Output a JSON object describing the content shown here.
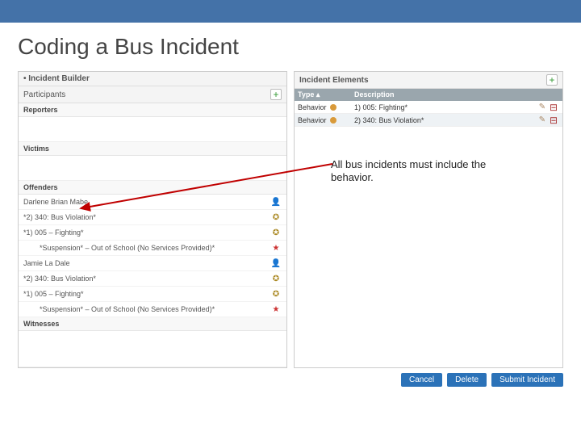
{
  "slide": {
    "title": "Coding a Bus Incident"
  },
  "builder": {
    "title": "Incident Builder"
  },
  "left": {
    "participants": "Participants",
    "reporters": "Reporters",
    "victims": "Victims",
    "offenders": "Offenders",
    "witnesses": "Witnesses",
    "offender_rows": {
      "o1_name": "Darlene Brian Mabe",
      "o1_line1": "*2) 340: Bus Violation*",
      "o1_line2": "*1) 005 – Fighting*",
      "o1_line3": "*Suspension* – Out of School (No Services Provided)*",
      "o2_name": "Jamie La Dale",
      "o2_line1": "*2) 340: Bus Violation*",
      "o2_line2": "*1) 005 – Fighting*",
      "o2_line3": "*Suspension* – Out of School (No Services Provided)*"
    }
  },
  "right": {
    "title": "Incident Elements",
    "col_type": "Type",
    "col_desc": "Description",
    "r1_type": "Behavior",
    "r1_desc": "1) 005: Fighting*",
    "r2_type": "Behavior",
    "r2_desc": "2) 340: Bus Violation*"
  },
  "callout": "All bus incidents must include the behavior.",
  "buttons": {
    "cancel": "Cancel",
    "delete": "Delete",
    "submit": "Submit Incident"
  }
}
